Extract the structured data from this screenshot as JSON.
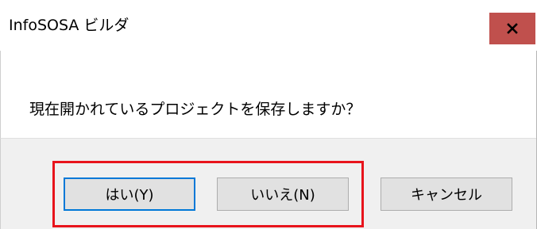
{
  "dialog": {
    "title": "InfoSOSA ビルダ",
    "close_icon": "close-icon",
    "message": "現在開かれているプロジェクトを保存しますか？",
    "buttons": {
      "yes_label": "はい(Y)",
      "no_label": "いいえ(N)",
      "cancel_label": "キャンセル"
    }
  },
  "colors": {
    "close_button_bg": "#c0504d",
    "footer_bg": "#f0f0f0",
    "highlight_border": "#e8141c",
    "default_button_border": "#0078d7"
  }
}
